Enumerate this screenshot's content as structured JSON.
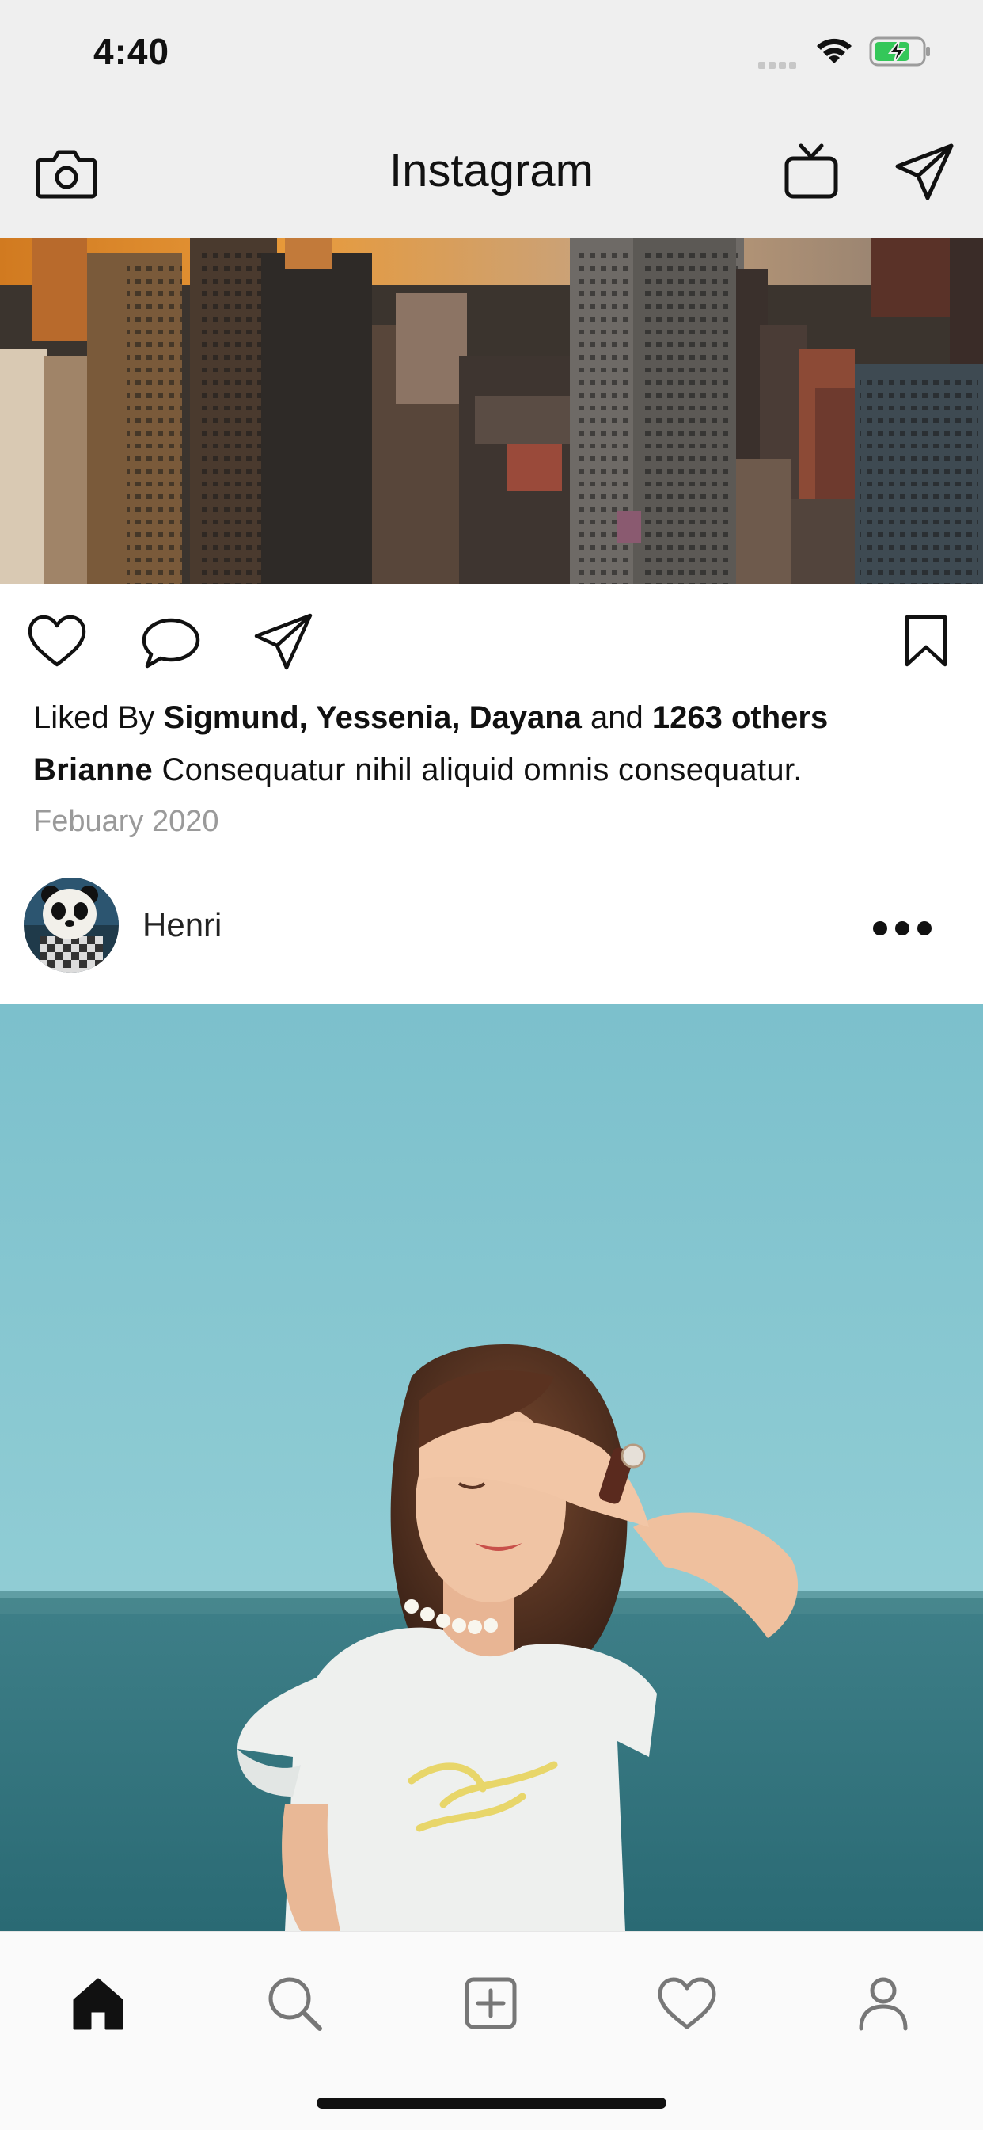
{
  "status_bar": {
    "time": "4:40",
    "wifi_icon": "wifi-icon",
    "battery_icon": "battery-charging-icon",
    "battery_color": "#34c759"
  },
  "header": {
    "title": "Instagram",
    "left_icon": "camera-icon",
    "right_icons": [
      "igtv-icon",
      "paper-plane-icon"
    ]
  },
  "post1": {
    "image": "city-skyline-photo",
    "actions": [
      "heart-icon",
      "comment-icon",
      "paper-plane-icon",
      "bookmark-icon"
    ],
    "likes_prefix": "Liked By ",
    "likes_names": "Sigmund, Yessenia, Dayana",
    "likes_and": " and ",
    "likes_count": "1263 others",
    "caption_user": "Brianne",
    "caption_text": " Consequatur nihil aliquid omnis consequatur.",
    "date": "Febuary 2020"
  },
  "post2": {
    "avatar": "panda-avatar",
    "username": "Henri",
    "more_icon": "more-dots-icon",
    "image": "woman-by-sea-photo"
  },
  "tab_bar": {
    "tabs": [
      "home-icon",
      "search-icon",
      "add-post-icon",
      "activity-heart-icon",
      "profile-icon"
    ],
    "active": "home-icon"
  }
}
